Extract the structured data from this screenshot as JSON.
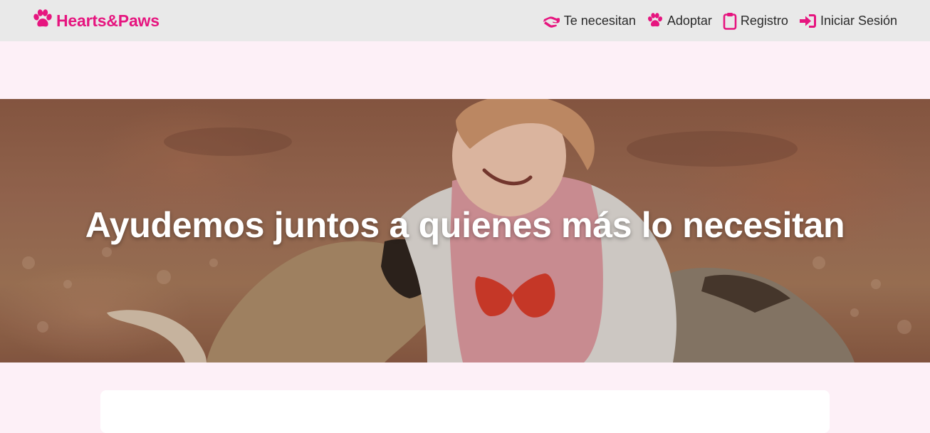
{
  "brand": {
    "name": "Hearts&Paws",
    "icon": "paw-icon",
    "color": "#e6157f"
  },
  "nav": {
    "items": [
      {
        "label": "Te necesitan",
        "icon": "helping-hand-icon"
      },
      {
        "label": "Adoptar",
        "icon": "paw-icon"
      },
      {
        "label": "Registro",
        "icon": "clipboard-icon"
      },
      {
        "label": "Iniciar Sesión",
        "icon": "sign-in-icon"
      }
    ],
    "accent": "#e6157f",
    "background": "#e9e9e9"
  },
  "hero": {
    "title": "Ayudemos juntos a quienes más lo necesitan",
    "image": "girl-with-dogs-photo"
  },
  "page": {
    "background": "#fdf0f7"
  }
}
